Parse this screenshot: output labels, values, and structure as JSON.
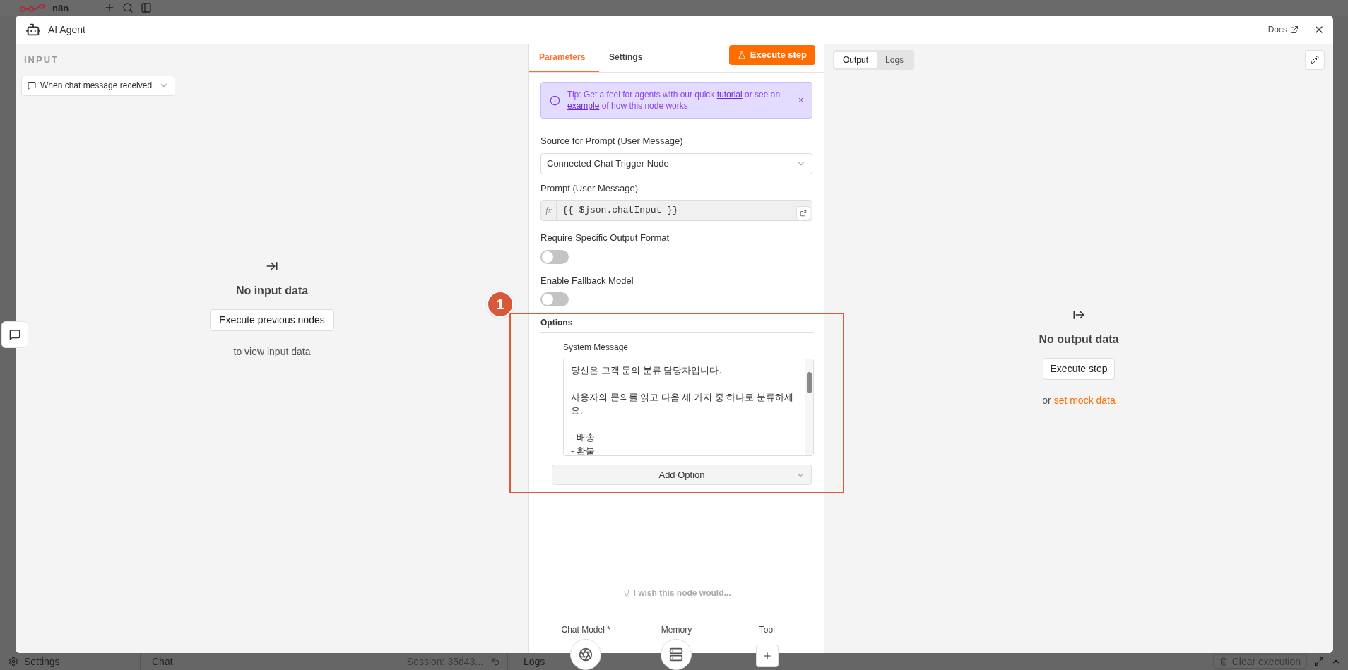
{
  "app": {
    "logo_text": "n8n",
    "bottom_bar": {
      "settings": "Settings",
      "chat": "Chat",
      "session": "Session: 35d43...",
      "logs": "Logs",
      "clear": "Clear execution"
    }
  },
  "modal": {
    "title": "AI Agent",
    "docs": "Docs"
  },
  "input_panel": {
    "heading": "INPUT",
    "trigger": "When chat message received",
    "empty_title": "No input data",
    "button": "Execute previous nodes",
    "hint": "to view input data"
  },
  "parameters_panel": {
    "tabs": [
      {
        "label": "Parameters",
        "selected": true
      },
      {
        "label": "Settings",
        "selected": false
      }
    ],
    "execute": "Execute step",
    "tip": [
      {
        "text": "Tip: Get a feel for agents with our quick ",
        "link": false
      },
      {
        "text": "tutorial",
        "link": true
      },
      {
        "text": " or see an ",
        "link": false
      },
      {
        "text": "example",
        "link": true
      },
      {
        "text": " of how this node works",
        "link": false
      }
    ],
    "tip_close": "×",
    "fields": [
      {
        "kind": "select",
        "label": "Source for Prompt (User Message)",
        "value": "Connected Chat Trigger Node"
      },
      {
        "kind": "expression",
        "label": "Prompt (User Message)",
        "prefix": "fx",
        "value": "{{ $json.chatInput }}"
      },
      {
        "kind": "toggle",
        "label": "Require Specific Output Format",
        "on": false
      },
      {
        "kind": "toggle",
        "label": "Enable Fallback Model",
        "on": false
      }
    ],
    "options": {
      "heading": "Options",
      "system_message": {
        "label": "System Message",
        "value": "당신은 고객 문의 분류 담당자입니다.\n\n사용자의 문의를 읽고 다음 세 가지 중 하나로 분류하세요.\n\n- 배송\n- 환불"
      },
      "add_option": "Add Option"
    },
    "wish": "I wish this node would...",
    "connectors": [
      {
        "label": "Chat Model *",
        "kind": "model"
      },
      {
        "label": "Memory",
        "kind": "memory"
      },
      {
        "label": "Tool",
        "kind": "add"
      }
    ]
  },
  "output_panel": {
    "tabs": [
      {
        "label": "Output",
        "selected": true
      },
      {
        "label": "Logs",
        "selected": false
      }
    ],
    "empty_title": "No output data",
    "button": "Execute step",
    "hint_prefix": "or",
    "hint_link": "set mock data"
  },
  "annotation": {
    "badge": "1"
  }
}
